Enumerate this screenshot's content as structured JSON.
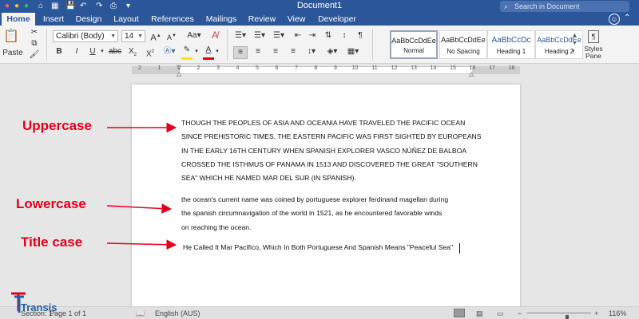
{
  "window": {
    "title": "Document1"
  },
  "quick_access": {
    "icons": [
      "close-dot-icon",
      "minimize-dot-icon",
      "zoom-dot-icon",
      "home-icon",
      "save-icon",
      "undo-icon",
      "redo-icon",
      "print-icon"
    ]
  },
  "search": {
    "placeholder": "Search in Document"
  },
  "tabs": [
    {
      "label": "Home",
      "active": true
    },
    {
      "label": "Insert"
    },
    {
      "label": "Design"
    },
    {
      "label": "Layout"
    },
    {
      "label": "References"
    },
    {
      "label": "Mailings"
    },
    {
      "label": "Review"
    },
    {
      "label": "View"
    },
    {
      "label": "Developer"
    }
  ],
  "ribbon": {
    "paste_label": "Paste",
    "font_name": "Calibri (Body)",
    "font_size": "14",
    "grow_font": "A",
    "shrink_font": "A",
    "change_case": "Aa",
    "bold": "B",
    "italic": "I",
    "underline": "U",
    "strikethrough": "abc",
    "subscript": "X",
    "superscript": "X",
    "highlight_color": "#ffe600",
    "font_color": "#e3001b",
    "styles": [
      {
        "sample": "AaBbCcDdEe",
        "name": "Normal",
        "selected": true
      },
      {
        "sample": "AaBbCcDdEe",
        "name": "No Spacing"
      },
      {
        "sample": "AaBbCcDc",
        "name": "Heading 1"
      },
      {
        "sample": "AaBbCcDdEe",
        "name": "Heading 2"
      }
    ],
    "styles_pane_label": "Styles Pane"
  },
  "ruler": {
    "numbers": [
      "2",
      "1",
      "1",
      "2",
      "3",
      "4",
      "5",
      "6",
      "7",
      "8",
      "9",
      "10",
      "11",
      "12",
      "13",
      "14",
      "15",
      "16",
      "17",
      "18"
    ]
  },
  "document": {
    "paragraphs": {
      "uppercase_lines": [
        "THOUGH THE PEOPLES OF ASIA AND OCEANIA HAVE TRAVELED THE PACIFIC OCEAN",
        "SINCE PREHISTORIC TIMES, THE EASTERN PACIFIC WAS FIRST SIGHTED BY EUROPEANS",
        "IN THE EARLY 16TH CENTURY WHEN SPANISH EXPLORER VASCO NÚÑEZ DE BALBOA",
        "CROSSED THE ISTHMUS OF PANAMA IN 1513 AND DISCOVERED THE GREAT \"SOUTHERN",
        "SEA\" WHICH HE NAMED MAR DEL SUR (IN SPANISH)."
      ],
      "lowercase_lines": [
        "the ocean's current name was coined by portuguese explorer ferdinand magellan during",
        "the spanish circumnavigation of the world in 1521, as he encountered favorable winds",
        "on reaching the ocean."
      ],
      "titlecase_lines": [
        "He Called It Mar Pacífico, Which In Both Portuguese And Spanish Means \"Peaceful Sea\""
      ]
    }
  },
  "annotations": {
    "uppercase": "Uppercase",
    "lowercase": "Lowercase",
    "titlecase": "Title case",
    "color": "#e3001b"
  },
  "status": {
    "section": "Section: 1",
    "page": "Page 1 of 1",
    "language": "English (AUS)",
    "zoom": "116%",
    "zoom_fraction": 0.62
  },
  "logo": {
    "text": "Transis",
    "primary_color": "#1f5fa8",
    "accent_color": "#e3001b"
  }
}
